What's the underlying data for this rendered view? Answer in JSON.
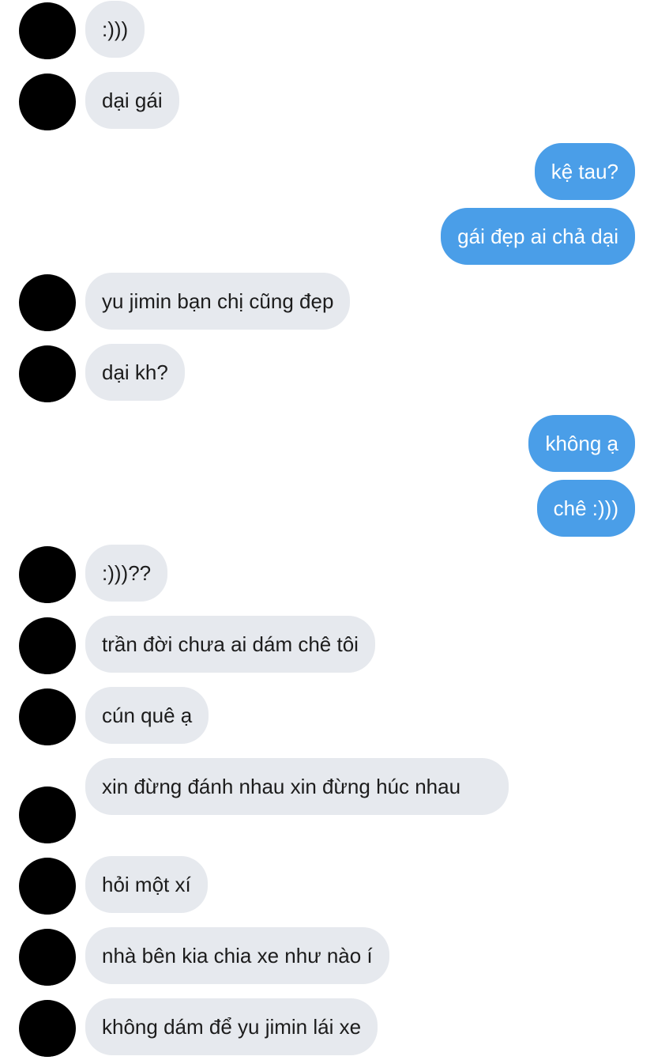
{
  "messages": [
    {
      "text": ":)))"
    },
    {
      "text": "dại gái"
    },
    {
      "text": "kệ tau?"
    },
    {
      "text": "gái đẹp ai chả dại"
    },
    {
      "text": "yu jimin bạn chị cũng đẹp"
    },
    {
      "text": "dại kh?"
    },
    {
      "text": "không ạ"
    },
    {
      "text": "chê :)))"
    },
    {
      "text": ":)))??"
    },
    {
      "text": "trần đời chưa ai dám chê tôi"
    },
    {
      "text": "cún quê ạ"
    },
    {
      "text": "xin đừng đánh nhau xin đừng húc nhau"
    },
    {
      "text": "hỏi một xí"
    },
    {
      "text": "nhà bên kia chia xe như nào í"
    },
    {
      "text": "không dám để yu jimin lái xe"
    }
  ],
  "colors": {
    "incoming_bubble": "#e6e9ee",
    "outgoing_bubble": "#4a9ee8",
    "incoming_text": "#1c1c1c",
    "outgoing_text": "#ffffff"
  },
  "avatars": [
    "profile-photo-orange-hair",
    "profile-photo-dark-hair",
    "profile-photo-grayscale",
    "profile-photo-color",
    "profile-photo-black-white"
  ]
}
